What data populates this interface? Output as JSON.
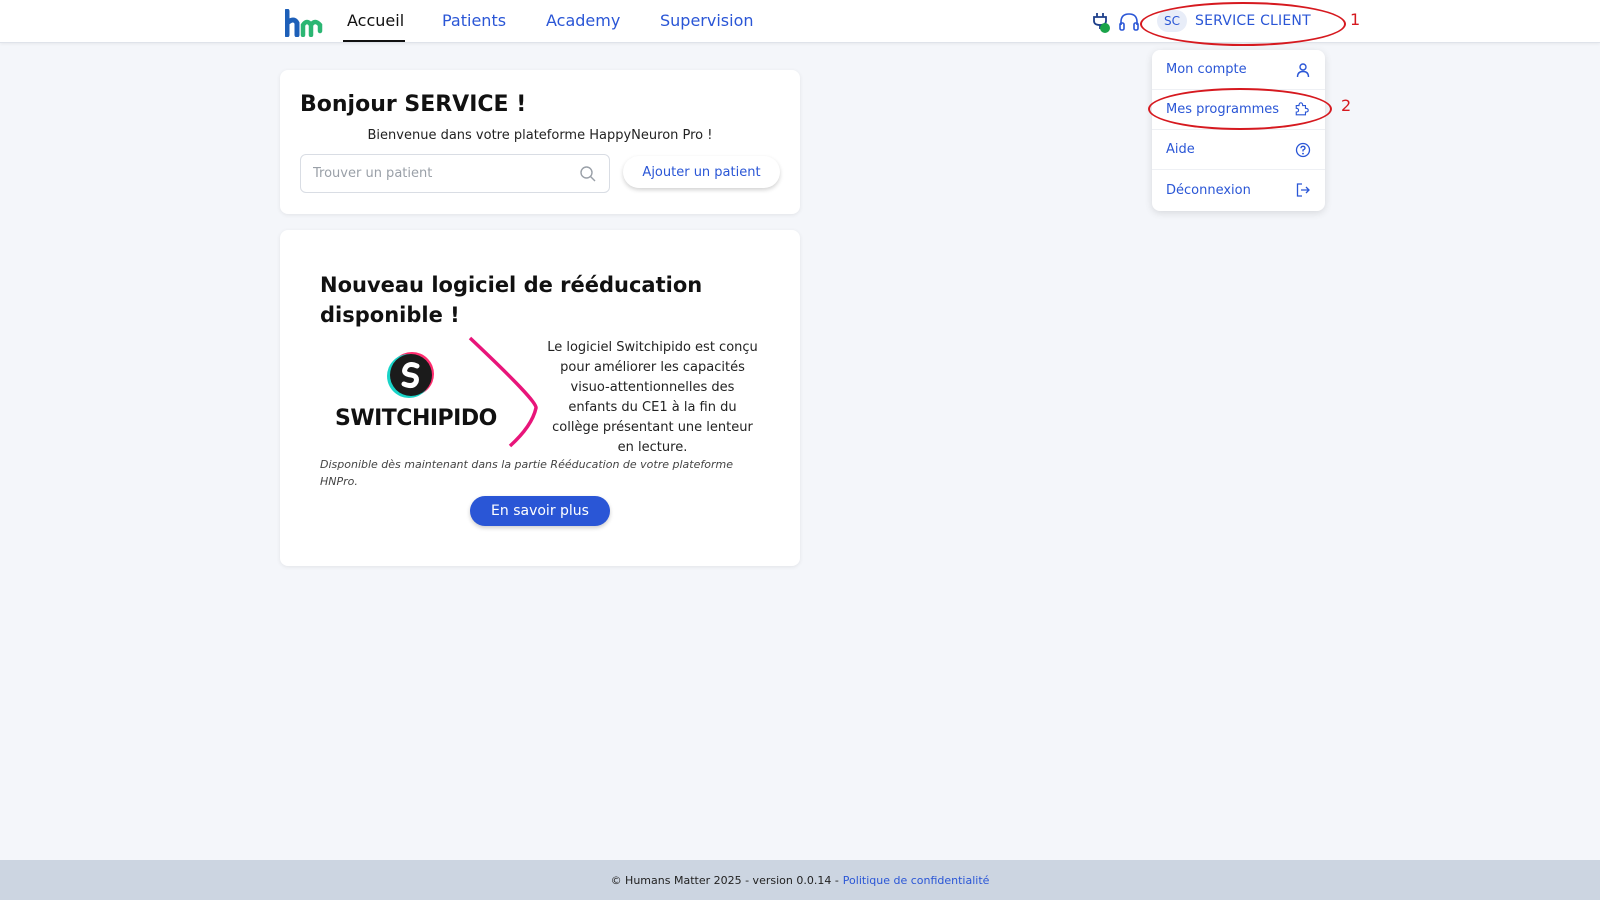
{
  "nav": {
    "logo": "hm-logo",
    "items": [
      {
        "label": "Accueil",
        "active": true
      },
      {
        "label": "Patients",
        "active": false
      },
      {
        "label": "Academy",
        "active": false
      },
      {
        "label": "Supervision",
        "active": false
      }
    ],
    "status_color": "#1aa34a"
  },
  "user": {
    "initials": "SC",
    "name": "SERVICE CLIENT"
  },
  "menu": {
    "items": [
      {
        "label": "Mon compte",
        "icon": "user-icon"
      },
      {
        "label": "Mes programmes",
        "icon": "puzzle-icon"
      },
      {
        "label": "Aide",
        "icon": "help-icon"
      },
      {
        "label": "Déconnexion",
        "icon": "logout-icon"
      }
    ]
  },
  "annotations": {
    "one": "1",
    "two": "2"
  },
  "welcome_card": {
    "greeting": "Bonjour SERVICE !",
    "welcome": "Bienvenue dans votre plateforme HappyNeuron Pro !",
    "search_placeholder": "Trouver un patient",
    "add_label": "Ajouter un patient"
  },
  "promo_card": {
    "title": "Nouveau logiciel de rééducation disponible !",
    "logo_text": "SWITCHIPIDO",
    "description": "Le logiciel Switchipido est conçu pour améliorer les capacités visuo-attentionnelles des enfants du CE1 à la fin du collège présentant une lenteur en lecture.",
    "note": "Disponible dès maintenant dans la partie Rééducation de votre plateforme HNPro.",
    "button_label": "En savoir plus"
  },
  "footer": {
    "text": "© Humans Matter 2025 - version 0.0.14 -",
    "link": "Politique de confidentialité"
  },
  "colors": {
    "accent": "#2a56d6",
    "annotation": "#d6191f",
    "pink": "#e8157a"
  }
}
